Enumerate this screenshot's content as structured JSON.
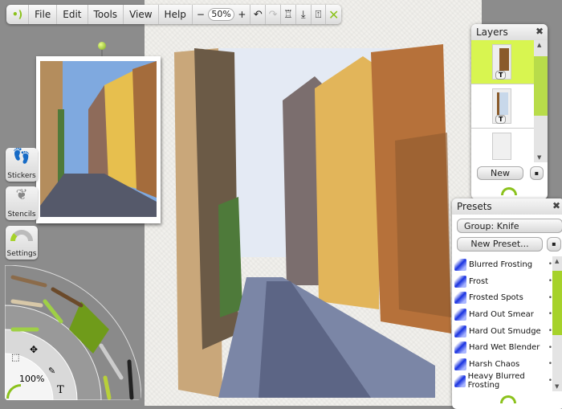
{
  "toolbar": {
    "menu": [
      "File",
      "Edit",
      "Tools",
      "View",
      "Help"
    ],
    "zoom_out": "−",
    "zoom": "50%",
    "zoom_in": "+"
  },
  "side": {
    "stickers": "Stickers",
    "stencils": "Stencils",
    "settings": "Settings"
  },
  "wheel": {
    "zoom": "100%",
    "text_tool": "T"
  },
  "layers": {
    "title": "Layers",
    "new": "New",
    "badge": "T"
  },
  "presets": {
    "title": "Presets",
    "group": "Group: Knife",
    "new_preset": "New Preset...",
    "items": [
      "Blurred Frosting",
      "Frost",
      "Frosted Spots",
      "Hard Out Smear",
      "Hard Out Smudge",
      "Hard Wet Blender",
      "Harsh Chaos",
      "Heavy Blurred Frosting"
    ]
  },
  "colors": {
    "accent": "#a6d22a",
    "highlight": "#d8f550"
  }
}
